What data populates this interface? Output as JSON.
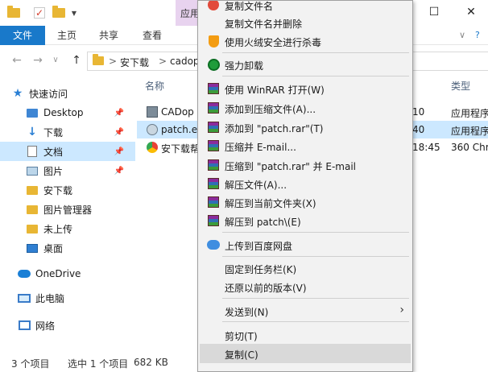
{
  "titlebar": {
    "context_tab": "应用",
    "minimize": "—",
    "maximize": "☐",
    "close": "✕"
  },
  "ribbon": {
    "tabs": [
      "文件",
      "主页",
      "共享",
      "查看"
    ],
    "collapse": "∨",
    "help": "?"
  },
  "address": {
    "back": "←",
    "forward": "→",
    "dropdown": "∨",
    "up": "↑",
    "sep": ">",
    "crumbs": [
      "安下载",
      "cadop"
    ]
  },
  "nav": {
    "items": [
      {
        "label": "快速访问",
        "icon": "star-icon"
      },
      {
        "label": "Desktop",
        "icon": "folder-icon",
        "pinned": true
      },
      {
        "label": "下载",
        "icon": "download-icon",
        "pinned": true
      },
      {
        "label": "文档",
        "icon": "document-icon",
        "pinned": true,
        "selected": true
      },
      {
        "label": "图片",
        "icon": "picture-icon",
        "pinned": true
      },
      {
        "label": "安下载",
        "icon": "folder-icon"
      },
      {
        "label": "图片管理器",
        "icon": "folder-icon"
      },
      {
        "label": "未上传",
        "icon": "folder-icon"
      },
      {
        "label": "桌面",
        "icon": "desktop-icon"
      },
      {
        "label": "OneDrive",
        "icon": "cloud-icon"
      },
      {
        "label": "此电脑",
        "icon": "computer-icon"
      },
      {
        "label": "网络",
        "icon": "network-icon"
      }
    ],
    "pin_glyph": "📌"
  },
  "filelist": {
    "col_name": "名称",
    "col_type": "类型",
    "rows": [
      {
        "name": "CADop",
        "time": "10",
        "type": "应用程序"
      },
      {
        "name": "patch.e",
        "time": "40",
        "type": "应用程序",
        "selected": true
      },
      {
        "name": "安下载帮",
        "time": "18:45",
        "type": "360 Chr"
      }
    ]
  },
  "status": {
    "count": "3 个项目",
    "selected": "选中 1 个项目",
    "size": "682 KB"
  },
  "menu": {
    "items": [
      {
        "label": "复制文件名",
        "icon": "red-circle-icon"
      },
      {
        "label": "复制文件名并删除",
        "icon": ""
      },
      {
        "label": "使用火绒安全进行杀毒",
        "icon": "huorong-shield-icon"
      },
      {
        "label": "强力卸载",
        "icon": "uninstall-icon"
      },
      {
        "label": "使用 WinRAR 打开(W)",
        "icon": "winrar-icon"
      },
      {
        "label": "添加到压缩文件(A)...",
        "icon": "winrar-icon"
      },
      {
        "label": "添加到 \"patch.rar\"(T)",
        "icon": "winrar-icon"
      },
      {
        "label": "压缩并 E-mail...",
        "icon": "winrar-icon"
      },
      {
        "label": "压缩到 \"patch.rar\" 并 E-mail",
        "icon": "winrar-icon"
      },
      {
        "label": "解压文件(A)...",
        "icon": "winrar-icon"
      },
      {
        "label": "解压到当前文件夹(X)",
        "icon": "winrar-icon"
      },
      {
        "label": "解压到 patch\\(E)",
        "icon": "winrar-icon"
      },
      {
        "label": "上传到百度网盘",
        "icon": "baidu-netdisk-icon"
      },
      {
        "label": "固定到任务栏(K)",
        "icon": ""
      },
      {
        "label": "还原以前的版本(V)",
        "icon": ""
      },
      {
        "label": "发送到(N)",
        "icon": "",
        "submenu": "›"
      },
      {
        "label": "剪切(T)",
        "icon": ""
      },
      {
        "label": "复制(C)",
        "icon": "",
        "hover": true
      }
    ]
  },
  "colors": {
    "accent": "#1979ca",
    "selection": "#cce8ff",
    "menu_bg": "#f2f2f2",
    "menu_hover": "#d9d9d9"
  }
}
